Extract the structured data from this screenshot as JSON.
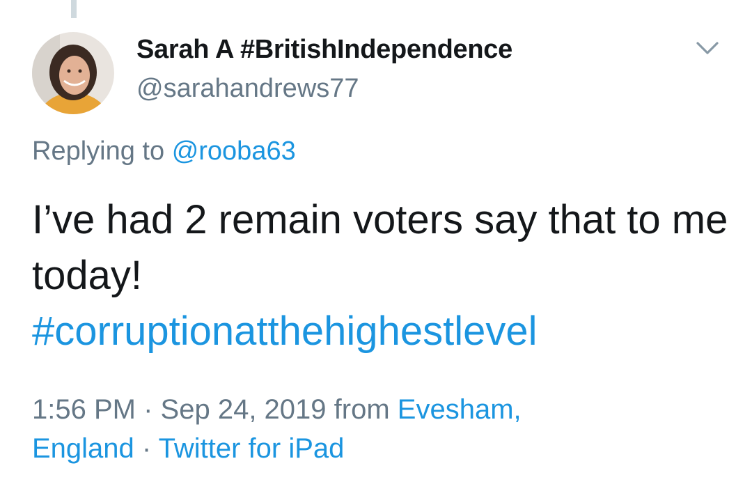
{
  "tweet": {
    "author": {
      "display_name": "Sarah A #BritishIndependence",
      "handle": "@sarahandrews77"
    },
    "replying_to": {
      "prefix": "Replying to",
      "mention": "@rooba63"
    },
    "text": "I’ve had 2 remain voters say that to me today!",
    "hashtag": "#corruptionatthehighestlevel",
    "meta": {
      "time": "1:56 PM",
      "separator": "·",
      "date": "Sep 24, 2019",
      "from_label": "from",
      "location_line1": "Evesham,",
      "location_line2": "England",
      "source": "Twitter for iPad"
    }
  },
  "icons": {
    "caret": "chevron-down-icon",
    "avatar": "profile-photo"
  },
  "colors": {
    "link": "#1b95e0",
    "secondary_text": "#657786",
    "primary_text": "#14171a",
    "thread_line": "#cfd9de"
  }
}
